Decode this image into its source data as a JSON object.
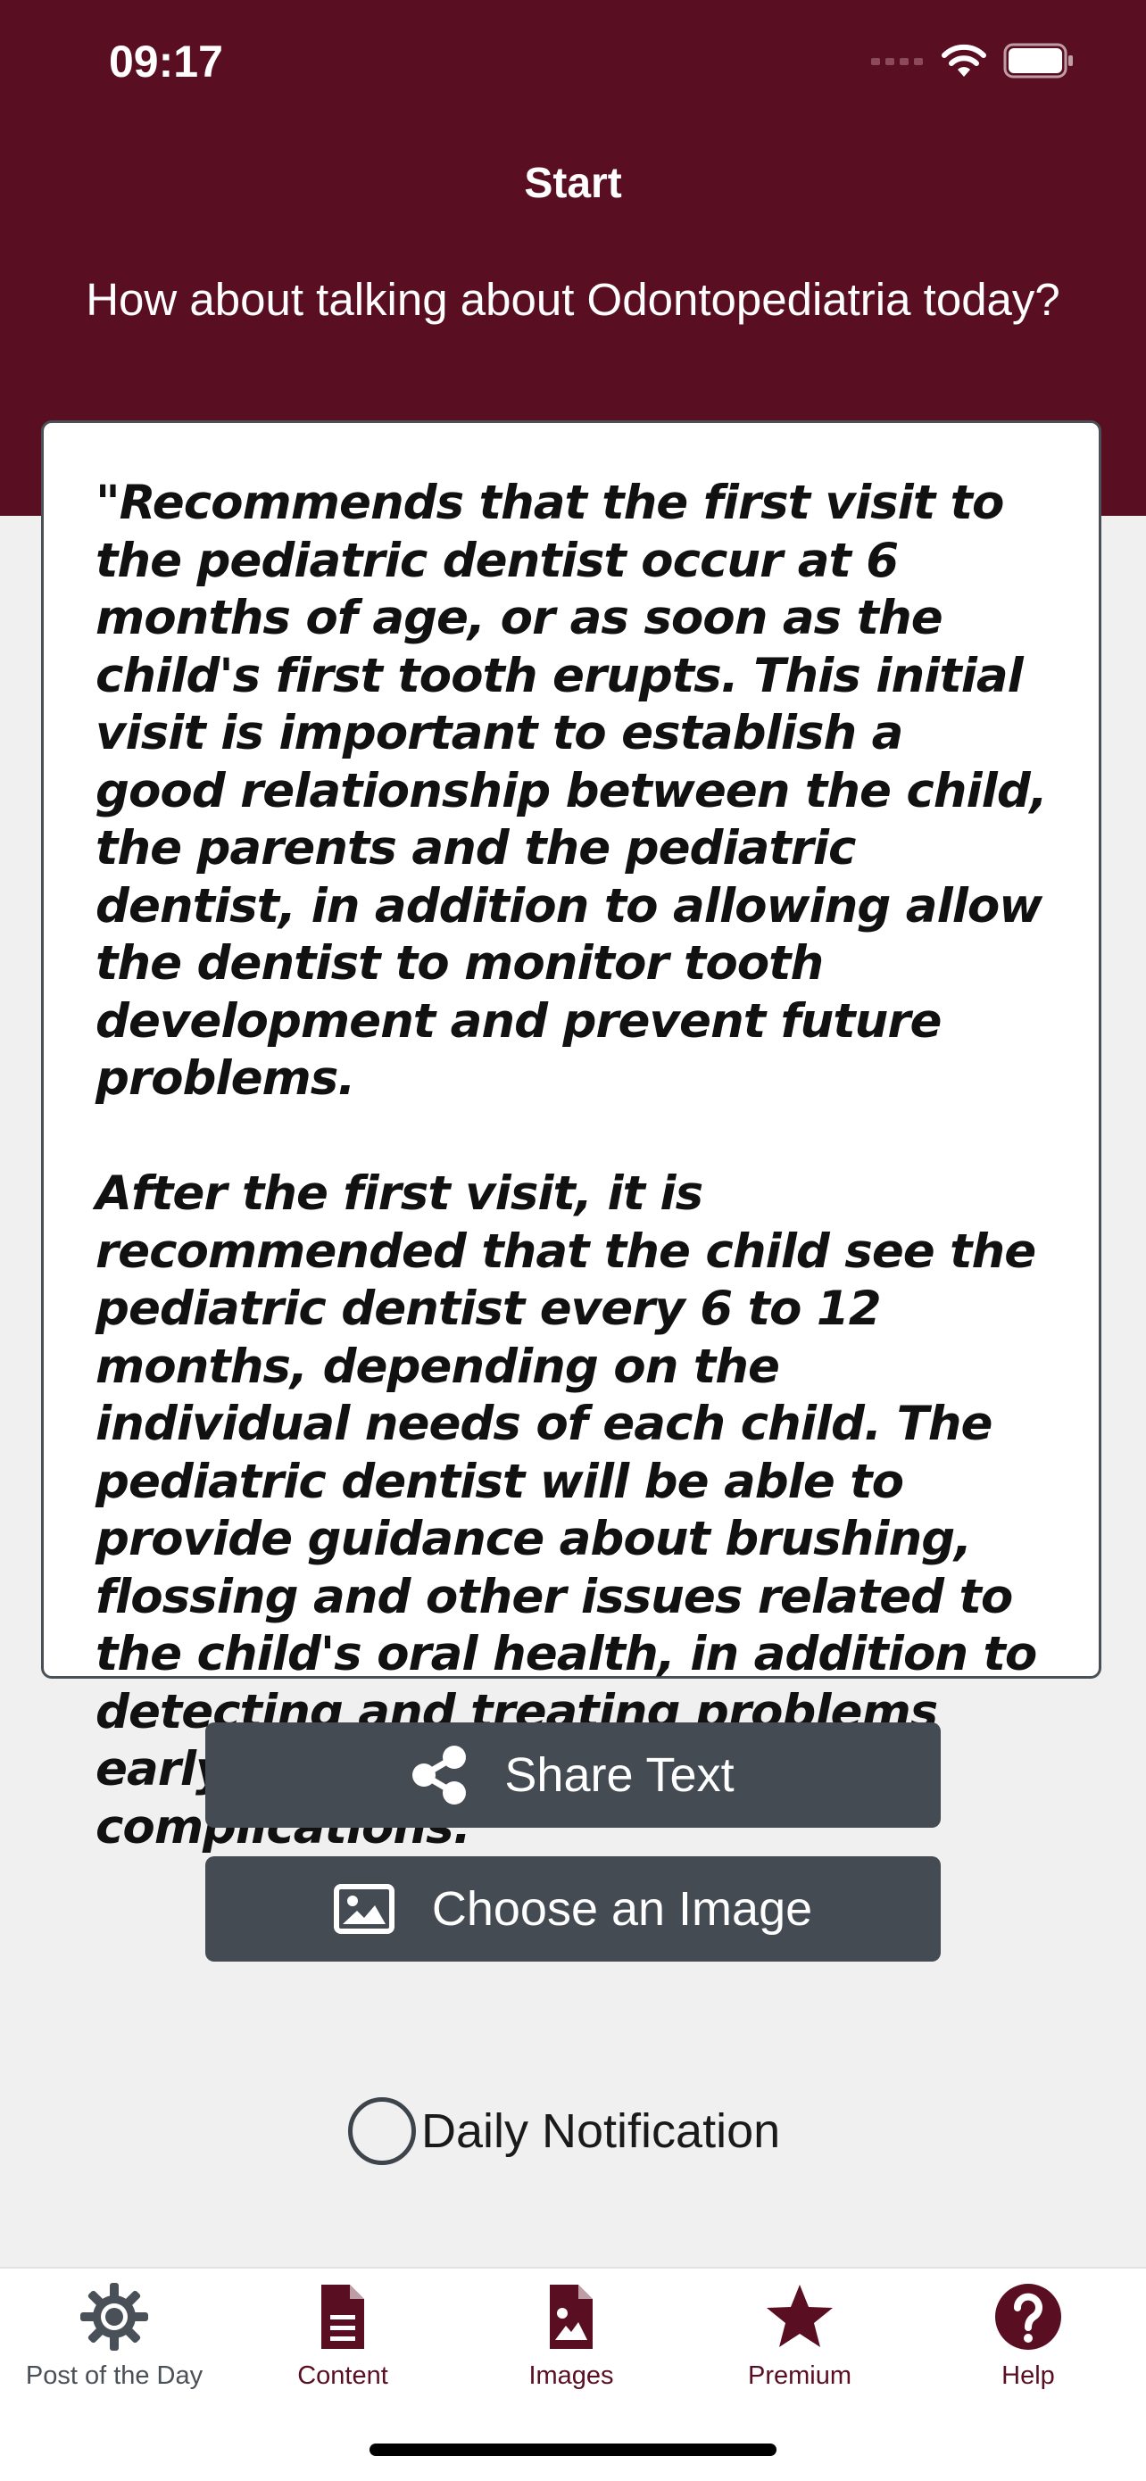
{
  "status_bar": {
    "time": "09:17"
  },
  "header": {
    "title": "Start",
    "subtitle": "How about talking about Odontopediatria today?"
  },
  "post": {
    "text": "\"Recommends that the first visit to the pediatric dentist occur at 6 months of age, or as soon as the child's first tooth erupts. This initial visit is important to establish a good relationship between the child, the parents and the pediatric dentist, in addition to allowing allow the dentist to monitor tooth development and prevent future problems.\n\nAfter the first visit, it is recommended that the child see the pediatric dentist every 6 to 12 months, depending on the individual needs of each child. The pediatric dentist will be able to provide guidance about brushing, flossing and other issues related to the child's oral health, in addition to detecting and treating problems early, which can prevent future complications.\""
  },
  "actions": {
    "share_label": "Share Text",
    "share_icon": "share-icon",
    "image_label": "Choose an Image",
    "image_icon": "image-icon"
  },
  "notification": {
    "label": "Daily Notification",
    "checked": false
  },
  "tabs": [
    {
      "label": "Post of the Day",
      "icon": "gear-icon",
      "active": true
    },
    {
      "label": "Content",
      "icon": "document-icon",
      "active": false
    },
    {
      "label": "Images",
      "icon": "image-file-icon",
      "active": false
    },
    {
      "label": "Premium",
      "icon": "star-icon",
      "active": false
    },
    {
      "label": "Help",
      "icon": "question-icon",
      "active": false
    }
  ],
  "colors": {
    "brand": "#5a0e22",
    "button": "#454b53",
    "background": "#f0f0f0",
    "active_tab": "#4a5058"
  }
}
